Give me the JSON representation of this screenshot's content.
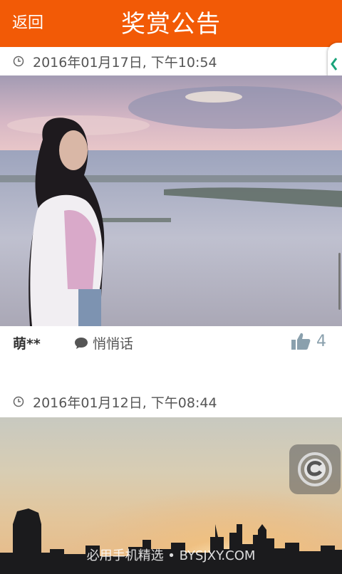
{
  "header": {
    "back_label": "返回",
    "title": "奖赏公告"
  },
  "posts": [
    {
      "time": "2016年01月17日, 下午10:54",
      "user": "萌**",
      "whisper_label": "悄悄话",
      "likes": "4"
    },
    {
      "time": "2016年01月12日, 下午08:44"
    }
  ],
  "watermark": "必用手机精选 • BYSJXY.COM",
  "colors": {
    "accent": "#f25a06"
  },
  "icons": [
    "clock-icon",
    "speech-bubble-icon",
    "thumbs-up-icon",
    "side-tab-chevron-icon",
    "floating-c-logo-icon"
  ]
}
